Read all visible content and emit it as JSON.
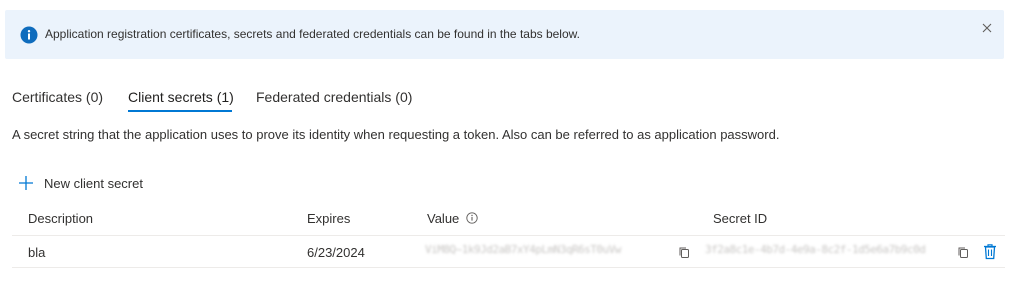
{
  "banner": {
    "message": "Application registration certificates, secrets and federated credentials can be found in the tabs below.",
    "icon": "info-icon",
    "close_icon": "close-icon",
    "accent": "#0f6cbd"
  },
  "tabs": [
    {
      "label": "Certificates (0)",
      "active": false
    },
    {
      "label": "Client secrets (1)",
      "active": true
    },
    {
      "label": "Federated credentials (0)",
      "active": false
    }
  ],
  "description": "A secret string that the application uses to prove its identity when requesting a token. Also can be referred to as application password.",
  "toolbar": {
    "new_secret_label": "New client secret",
    "icon": "plus-icon"
  },
  "table": {
    "columns": [
      "Description",
      "Expires",
      "Value",
      "Secret ID"
    ],
    "rows": [
      {
        "description": "bla",
        "expires": "6/23/2024",
        "value": "ViM8Q~1k9Jd2aB7xY4pLmN3qR6sT0uVw",
        "secret_id": "3f2a8c1e-4b7d-4e9a-8c2f-1d5e6a7b9c0d"
      }
    ]
  },
  "colors": {
    "accent": "#0078d4",
    "delete": "#0078d4"
  }
}
